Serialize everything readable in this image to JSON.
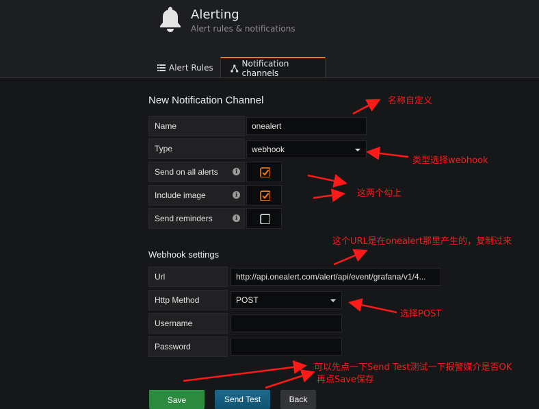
{
  "header": {
    "title": "Alerting",
    "subtitle": "Alert rules & notifications"
  },
  "tabs": [
    {
      "label": "Alert Rules",
      "icon": "list-icon",
      "active": false
    },
    {
      "label": "Notification channels",
      "icon": "share-icon",
      "active": true
    }
  ],
  "form": {
    "title": "New Notification Channel",
    "name_label": "Name",
    "name_value": "onealert",
    "type_label": "Type",
    "type_value": "webhook",
    "send_all_label": "Send on all alerts",
    "send_all_checked": true,
    "include_image_label": "Include image",
    "include_image_checked": true,
    "send_reminders_label": "Send reminders",
    "send_reminders_checked": false
  },
  "webhook": {
    "title": "Webhook settings",
    "url_label": "Url",
    "url_value": "http://api.onealert.com/alert/api/event/grafana/v1/4...",
    "method_label": "Http Method",
    "method_value": "POST",
    "username_label": "Username",
    "username_value": "",
    "password_label": "Password",
    "password_value": ""
  },
  "buttons": {
    "save": "Save",
    "send_test": "Send Test",
    "back": "Back"
  },
  "annotations": {
    "name_note": "名称自定义",
    "type_note": "类型选择webhook",
    "checkbox_note": "这两个勾上",
    "url_note": "这个URL是在onealert那里产生的，复制过来",
    "post_note": "选择POST",
    "test_note": "可以先点一下Send Test测试一下报警媒介是否OK",
    "save_note": "再点Save保存",
    "color": "#ff1a1a"
  },
  "colors": {
    "accent": "#eb7b18",
    "save_green": "#2b8a3e",
    "test_blue": "#105370"
  }
}
